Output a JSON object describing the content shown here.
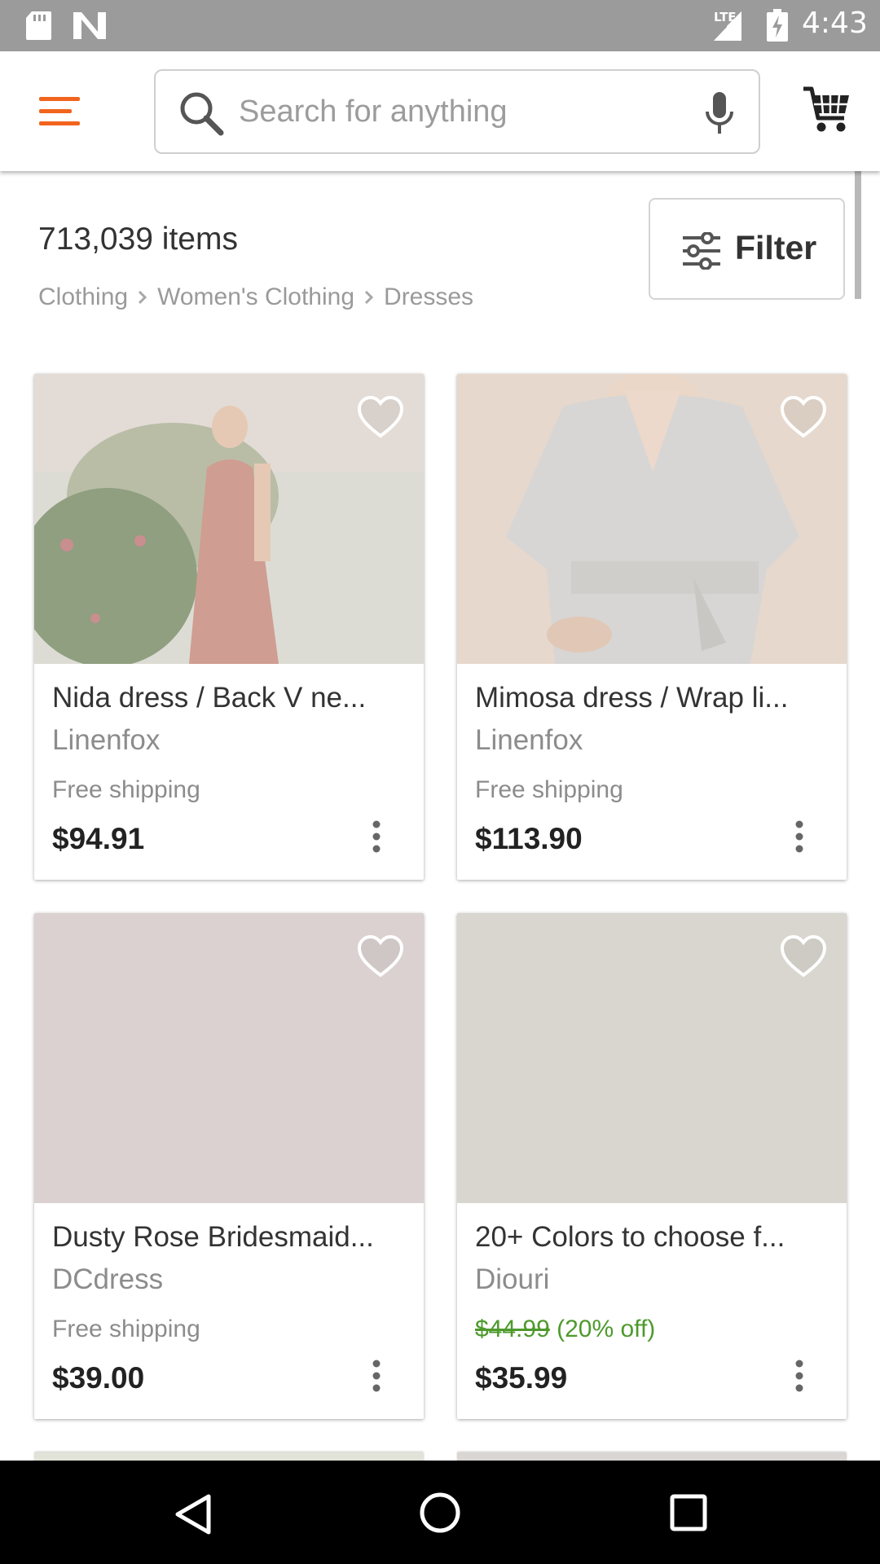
{
  "status_bar": {
    "network_label": "LTE",
    "time": "4:43",
    "icons": [
      "sd-card-icon",
      "n-notification-icon",
      "signal-icon",
      "battery-charging-icon"
    ]
  },
  "app_bar": {
    "search_placeholder": "Search for anything",
    "accent_color": "#f1641e",
    "icons": [
      "menu-icon",
      "search-icon",
      "mic-icon",
      "cart-icon"
    ]
  },
  "results": {
    "count_text": "713,039 items",
    "breadcrumb": [
      "Clothing",
      "Women's Clothing",
      "Dresses"
    ],
    "filter_label": "Filter"
  },
  "listings": [
    {
      "title": "Nida dress / Back V ne...",
      "shop": "Linenfox",
      "shipping": "Free shipping",
      "price": "$94.91",
      "favorited": false
    },
    {
      "title": "Mimosa dress / Wrap li...",
      "shop": "Linenfox",
      "shipping": "Free shipping",
      "price": "$113.90",
      "favorited": false
    },
    {
      "title": "Dusty Rose Bridesmaid...",
      "shop": "DCdress",
      "shipping": "Free shipping",
      "price": "$39.00",
      "favorited": false
    },
    {
      "title": "20+ Colors to choose f...",
      "shop": "Diouri",
      "original_price": "$44.99",
      "discount": "(20% off)",
      "price": "$35.99",
      "sale_color": "#4e9a2d",
      "favorited": false
    }
  ],
  "nav_bar": {
    "icons": [
      "back-icon",
      "home-icon",
      "recents-icon"
    ]
  }
}
